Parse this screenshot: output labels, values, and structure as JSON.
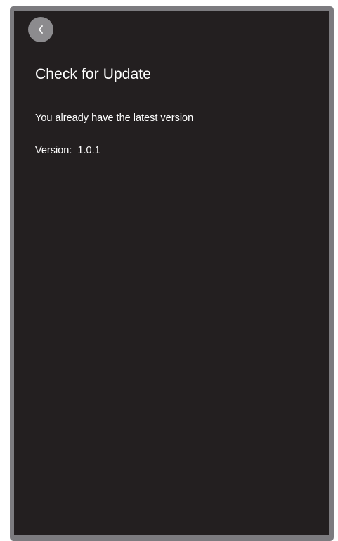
{
  "header": {
    "back_icon": "chevron-left-icon",
    "title": "Check for Update"
  },
  "update": {
    "status": "You already have the latest version",
    "version_label": "Version:",
    "version_value": "1.0.1"
  },
  "colors": {
    "frame": "#7c7b7f",
    "screen_background": "#231f20",
    "back_button": "#8c8b8e",
    "text": "#ffffff",
    "divider": "#e9e9e9"
  }
}
